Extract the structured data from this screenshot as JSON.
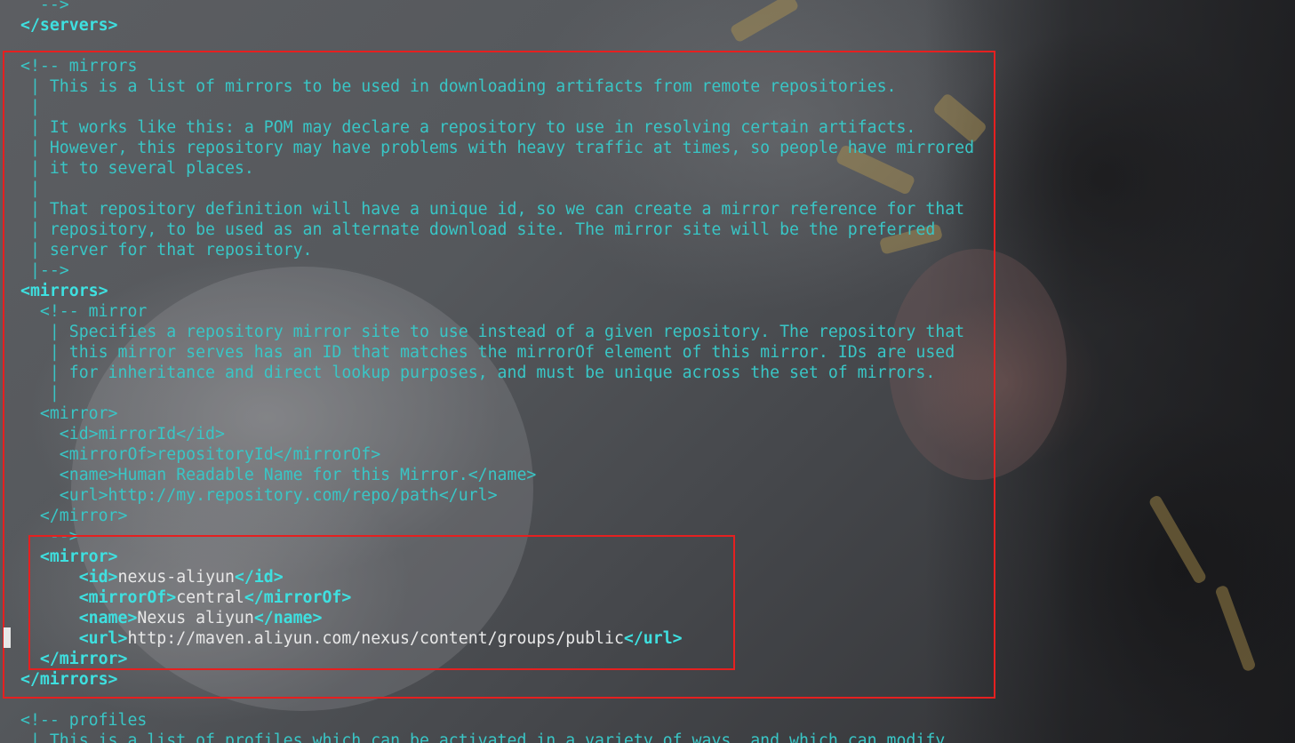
{
  "terminal": {
    "lines": [
      "  -->",
      "</servers>",
      "",
      "<!-- mirrors",
      " | This is a list of mirrors to be used in downloading artifacts from remote repositories.",
      " |",
      " | It works like this: a POM may declare a repository to use in resolving certain artifacts.",
      " | However, this repository may have problems with heavy traffic at times, so people have mirrored",
      " | it to several places.",
      " |",
      " | That repository definition will have a unique id, so we can create a mirror reference for that",
      " | repository, to be used as an alternate download site. The mirror site will be the preferred",
      " | server for that repository.",
      " |-->",
      "<mirrors>",
      "  <!-- mirror",
      "   | Specifies a repository mirror site to use instead of a given repository. The repository that",
      "   | this mirror serves has an ID that matches the mirrorOf element of this mirror. IDs are used",
      "   | for inheritance and direct lookup purposes, and must be unique across the set of mirrors.",
      "   |",
      "  <mirror>",
      "    <id>mirrorId</id>",
      "    <mirrorOf>repositoryId</mirrorOf>",
      "    <name>Human Readable Name for this Mirror.</name>",
      "    <url>http://my.repository.com/repo/path</url>",
      "  </mirror>",
      "   -->",
      "  <mirror>",
      "      <id>nexus-aliyun</id>",
      "      <mirrorOf>central</mirrorOf>",
      "      <name>Nexus aliyun</name>",
      "      <url>http://maven.aliyun.com/nexus/content/groups/public</url>",
      "  </mirror>",
      "</mirrors>",
      "",
      "<!-- profiles",
      " | This is a list of profiles which can be activated in a variety of ways, and which can modify"
    ],
    "highlighted_line_start": 0,
    "highlighted_lines": [
      1,
      14,
      27,
      28,
      29,
      30,
      31,
      32,
      33
    ]
  },
  "colors": {
    "comment": "#39c6c6",
    "tag": "#3ee0e0",
    "value": "#e8e8e8",
    "annotation_box": "#e52020"
  }
}
